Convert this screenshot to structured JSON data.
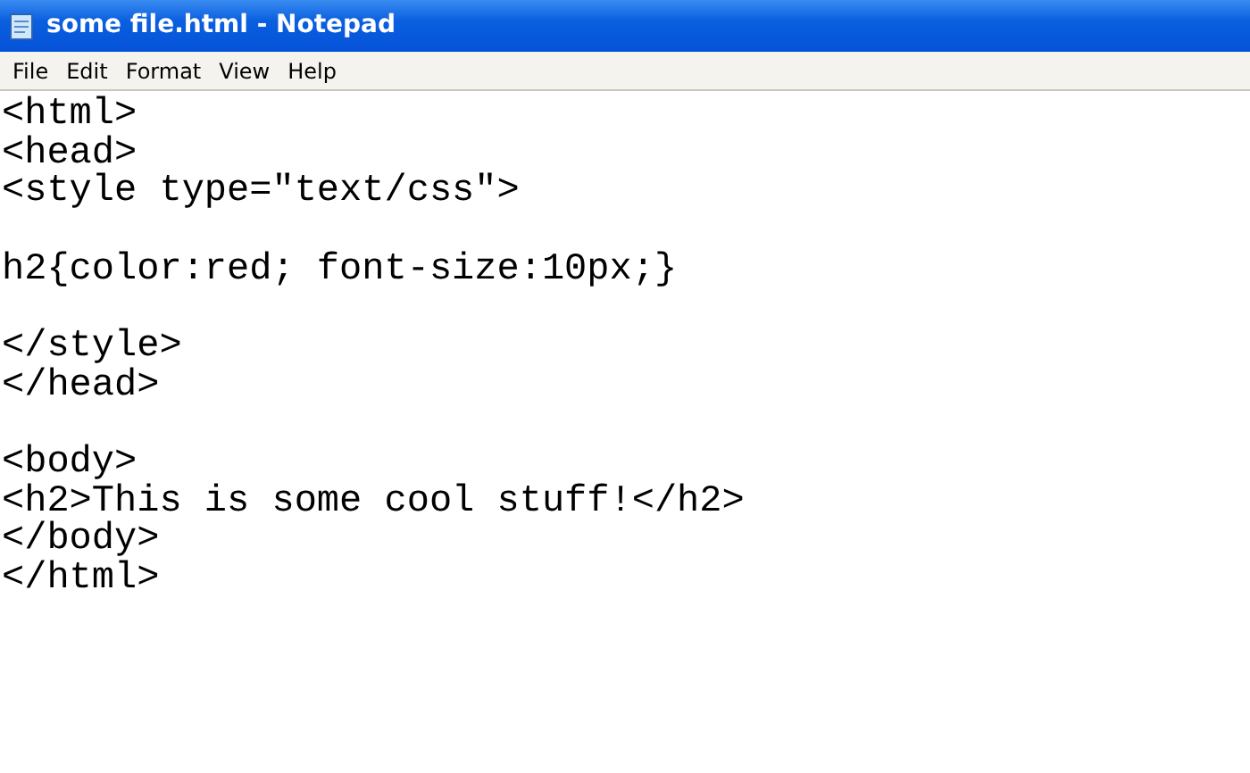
{
  "window": {
    "title": "some file.html - Notepad"
  },
  "menu": [
    "File",
    "Edit",
    "Format",
    "View",
    "Help"
  ],
  "editor": {
    "blocks": [
      [
        "<html>",
        "<head>",
        "<style type=\"text/css\">"
      ],
      [
        "h2{color:red; font-size:10px;}"
      ],
      [
        "</style>",
        "</head>"
      ],
      [
        "<body>",
        "<h2>This is some cool stuff!</h2>",
        "</body>",
        "</html>"
      ]
    ]
  }
}
